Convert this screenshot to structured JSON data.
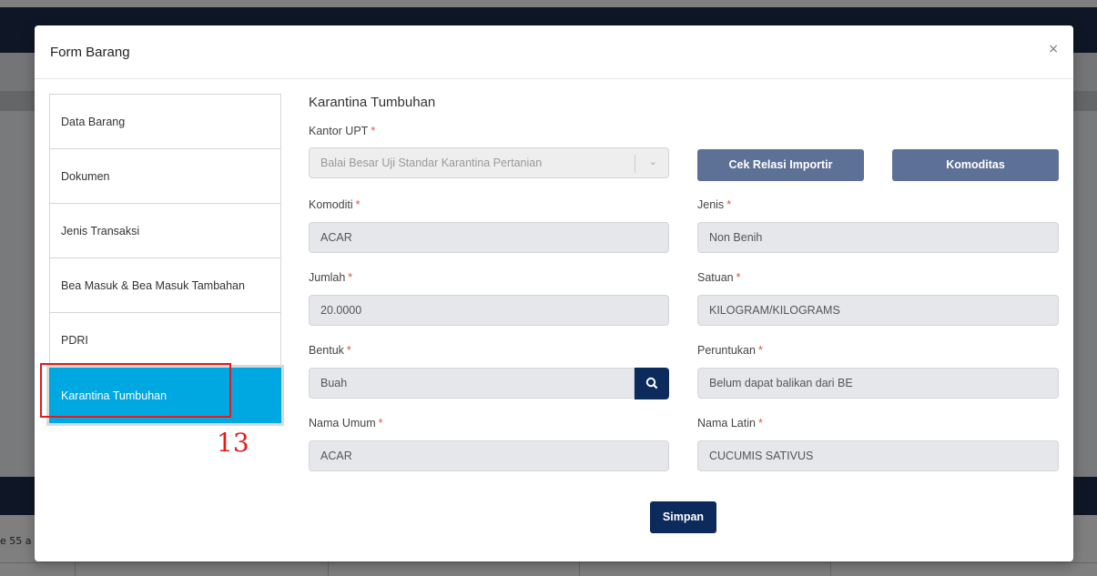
{
  "background": {
    "truncated_text": "e 55 a"
  },
  "modal": {
    "title": "Form Barang",
    "close_label": "×"
  },
  "sidebar": {
    "items": [
      {
        "label": "Data Barang"
      },
      {
        "label": "Dokumen"
      },
      {
        "label": "Jenis Transaksi"
      },
      {
        "label": "Bea Masuk & Bea Masuk Tambahan"
      },
      {
        "label": "PDRI"
      },
      {
        "label": "Karantina Tumbuhan",
        "active": true
      }
    ]
  },
  "annotation": {
    "number": "13"
  },
  "form": {
    "section_title": "Karantina Tumbuhan",
    "kantor_upt": {
      "label": "Kantor UPT",
      "value": "Balai Besar Uji Standar Karantina Pertanian"
    },
    "buttons": {
      "cek_relasi": "Cek Relasi Importir",
      "komoditas": "Komoditas",
      "simpan": "Simpan"
    },
    "komoditi": {
      "label": "Komoditi",
      "value": "ACAR"
    },
    "jenis": {
      "label": "Jenis",
      "value": "Non Benih"
    },
    "jumlah": {
      "label": "Jumlah",
      "value": "20.0000"
    },
    "satuan": {
      "label": "Satuan",
      "value": "KILOGRAM/KILOGRAMS"
    },
    "bentuk": {
      "label": "Bentuk",
      "value": "Buah"
    },
    "peruntukan": {
      "label": "Peruntukan",
      "value": "Belum dapat balikan dari BE"
    },
    "nama_umum": {
      "label": "Nama Umum",
      "value": "ACAR"
    },
    "nama_latin": {
      "label": "Nama Latin",
      "value": "CUCUMIS SATIVUS"
    },
    "required_mark": "*"
  },
  "colors": {
    "active_tab": "#00a8e1",
    "primary_button": "#0c2a5b",
    "secondary_button": "#5d7196",
    "annotation": "#e31b1b"
  }
}
